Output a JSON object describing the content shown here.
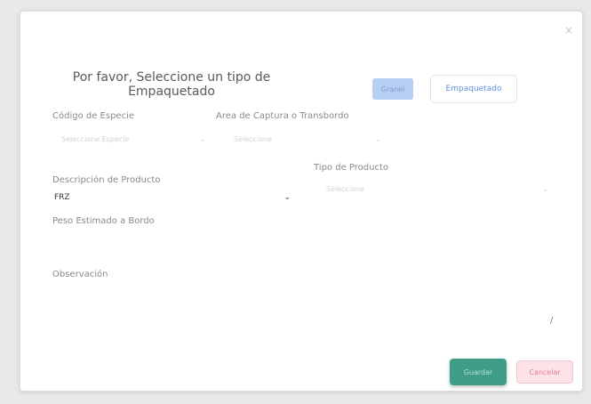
{
  "modal": {
    "close_icon": "×",
    "title": "Por favor, Seleccione un tipo de Empaquetado",
    "type_buttons": {
      "granel_label": "Granel",
      "empaquetado_label": "Empaquetado"
    }
  },
  "form": {
    "codigo_especie": {
      "label": "Código de Especie",
      "value": "Seleccione Especie"
    },
    "area_captura": {
      "label": "Area de Captura o Transbordo",
      "value": "Seleccione"
    },
    "descripcion_producto": {
      "label": "Descripción de Producto",
      "value": "FRZ"
    },
    "tipo_producto": {
      "label": "Tipo de Producto",
      "value": "Seleccione"
    },
    "peso_estimado": {
      "label": "Peso Estimado a Bordo"
    },
    "observacion": {
      "label": "Observación"
    }
  },
  "actions": {
    "save_label": "Guardar",
    "cancel_label": "Cancelar"
  },
  "icons": {
    "close": "close-icon",
    "chevron": "chevron-down-icon",
    "resize": "resize-handle-icon"
  },
  "colors": {
    "granel_bg": "#b7cff3",
    "empaquetado_text": "#5d93e0",
    "save_bg": "#3f9c86",
    "cancel_bg": "#fbe3e7",
    "cancel_text": "#e97a8e"
  }
}
